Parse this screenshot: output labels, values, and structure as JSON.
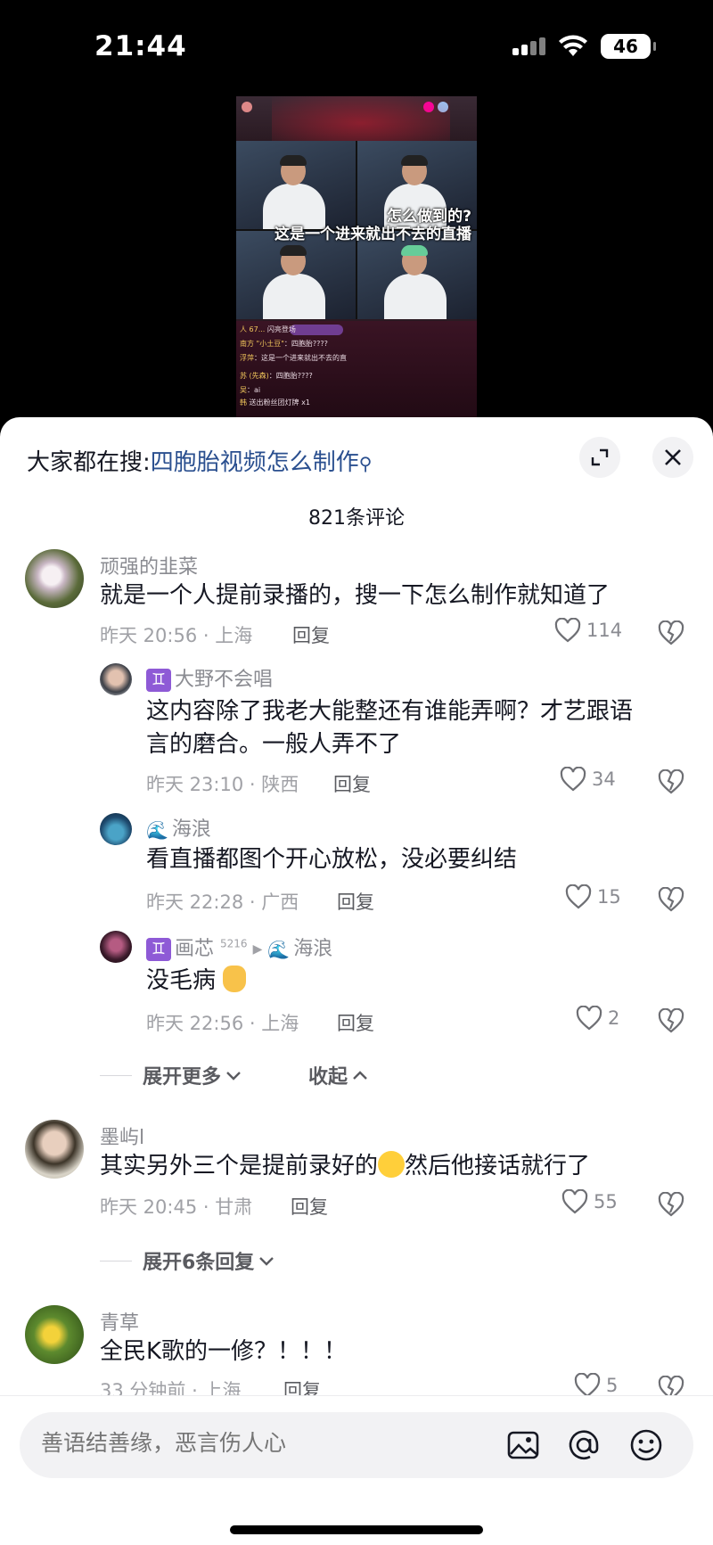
{
  "status_bar": {
    "time": "21:44",
    "battery": "46"
  },
  "video": {
    "caption_line1": "怎么做到的?",
    "caption_line2": "这是一个进来就出不去的直播",
    "chat": [
      {
        "name": "人 67...",
        "text": "闪亮登场"
      },
      {
        "name": "南方 \"小土豆\"",
        "text": "：四胞胎????"
      },
      {
        "name": "浮萍",
        "text": "：这是一个进来就出不去的直"
      },
      {
        "name": "苏 (先森)",
        "text": "：四胞胎????"
      },
      {
        "name": "吴",
        "text": "：ai"
      },
      {
        "name": "韩",
        "text": "送出粉丝团灯牌 x1"
      }
    ]
  },
  "sheet": {
    "search_prefix": "大家都在搜:",
    "search_link": "四胞胎视频怎么制作",
    "comment_count": "821条评论"
  },
  "comments": [
    {
      "user": "顽强的韭菜",
      "text": "就是一个人提前录播的，搜一下怎么制作就知道了",
      "meta": "昨天 20:56 · 上海",
      "reply": "回复",
      "likes": "114"
    },
    {
      "user": "大野不会唱",
      "text1": "这内容除了我老大能整还有谁能弄啊？才艺跟语",
      "text2": "言的磨合。一般人弄不了",
      "meta": "昨天 23:10 · 陕西",
      "reply": "回复",
      "likes": "34"
    },
    {
      "user": "海浪",
      "text": "看直播都图个开心放松，没必要纠结",
      "meta": "昨天 22:28 · 广西",
      "reply": "回复",
      "likes": "15"
    },
    {
      "user": "画芯",
      "sup": "5216",
      "reply_to": "海浪",
      "text": "没毛病",
      "meta": "昨天 22:56 · 上海",
      "reply": "回复",
      "likes": "2"
    },
    {
      "user": "墨屿l",
      "text_a": "其实另外三个是提前录好的",
      "text_b": "然后他接话就行了",
      "meta": "昨天 20:45 · 甘肃",
      "reply": "回复",
      "likes": "55"
    },
    {
      "user": "青草",
      "text": "全民K歌的一修？！！！",
      "meta": "33 分钟前 · 上海",
      "reply": "回复",
      "likes": "5"
    }
  ],
  "expand": {
    "more": "展开更多",
    "collapse": "收起",
    "six_replies": "展开6条回复"
  },
  "input": {
    "placeholder": "善语结善缘，恶言伤人心"
  },
  "colors": {
    "link": "#2a4f8f",
    "badge": "#8e5ad6",
    "text": "#161823",
    "muted": "#8a8b91"
  }
}
